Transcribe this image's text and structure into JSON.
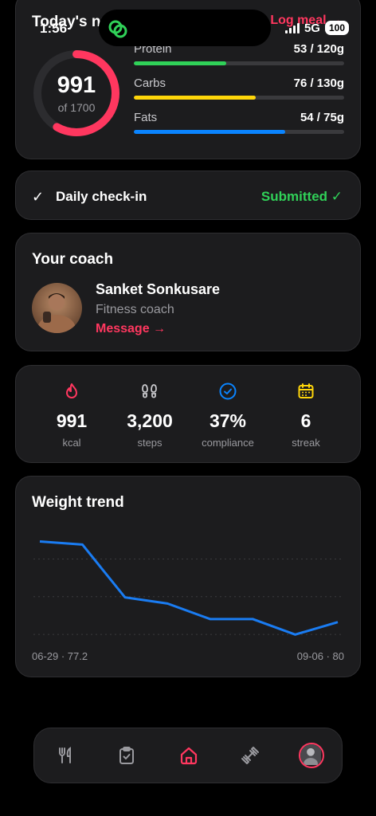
{
  "status": {
    "time": "1:56",
    "network": "5G",
    "battery": "100"
  },
  "summary": {
    "title": "Today's nutrition",
    "log_meal": "Log meal →",
    "calories": "991",
    "calories_sub": "of 1700",
    "calories_progress": 0.583,
    "macros": [
      {
        "name": "Protein",
        "value": "53 / 120g",
        "progress": 0.44,
        "color": "#30d158"
      },
      {
        "name": "Carbs",
        "value": "76 / 130g",
        "progress": 0.58,
        "color": "#ffd60a"
      },
      {
        "name": "Fats",
        "value": "54 / 75g",
        "progress": 0.72,
        "color": "#0a84ff"
      }
    ],
    "ring_color": "#ff375f"
  },
  "checkin": {
    "label": "Daily check-in",
    "status": "Submitted ✓",
    "check_icon": "checkmark-icon"
  },
  "coach": {
    "title": "Your coach",
    "name": "Sanket Sonkusare",
    "role": "Fitness coach",
    "message": "Message →"
  },
  "stats": [
    {
      "icon": "flame-icon",
      "value": "991",
      "label": "kcal",
      "color": "#ff375f"
    },
    {
      "icon": "footsteps-icon",
      "value": "3,200",
      "label": "steps",
      "color": "#c8c8cc"
    },
    {
      "icon": "check-circle-icon",
      "value": "37%",
      "label": "compliance",
      "color": "#0a84ff"
    },
    {
      "icon": "calendar-icon",
      "value": "6",
      "label": "streak",
      "color": "#ffd60a"
    }
  ],
  "weight_trend": {
    "title": "Weight trend",
    "start_label": "06-29 · 77.2",
    "end_label": "09-06 · 80"
  },
  "chart_data": {
    "type": "line",
    "title": "Weight trend",
    "series": [
      {
        "values": [
          80.0,
          79.9,
          78.2,
          78.0,
          77.5,
          77.5,
          77.0,
          77.4
        ]
      }
    ],
    "ylim": [
      76.7,
      80.5
    ],
    "grid": true,
    "color": "#1a7cf2"
  },
  "nav": [
    {
      "icon": "utensils-icon",
      "active": false
    },
    {
      "icon": "clipboard-icon",
      "active": false
    },
    {
      "icon": "home-icon",
      "active": true
    },
    {
      "icon": "dumbbell-icon",
      "active": false
    },
    {
      "icon": "profile-avatar",
      "active": false
    }
  ]
}
